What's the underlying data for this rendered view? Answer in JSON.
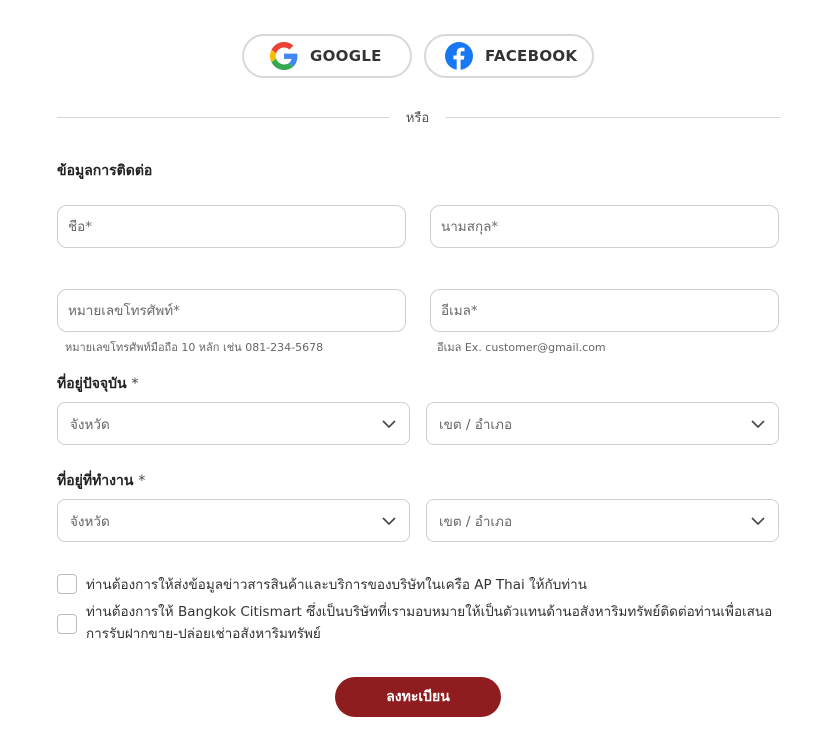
{
  "social": {
    "google_label": "GOOGLE",
    "facebook_label": "FACEBOOK"
  },
  "divider_text": "หรือ",
  "contact": {
    "title": "ข้อมูลการติดต่อ",
    "first_name_placeholder": "ชื่อ*",
    "last_name_placeholder": "นามสกุล*",
    "phone_placeholder": "หมายเลขโทรศัพท์*",
    "email_placeholder": "อีเมล*",
    "phone_hint": "หมายเลขโทรศัพท์มือถือ 10 หลัก เช่น 081-234-5678",
    "email_hint": "อีเมล Ex. customer@gmail.com"
  },
  "current_address": {
    "title": "ที่อยู่ปัจจุบัน",
    "required_mark": "*",
    "province": "จังหวัด",
    "district": "เขต / อำเภอ"
  },
  "work_address": {
    "title": "ที่อยู่ที่ทำงาน",
    "required_mark": "*",
    "province": "จังหวัด",
    "district": "เขต / อำเภอ"
  },
  "consents": [
    "ท่านต้องการให้ส่งข้อมูลข่าวสารสินค้าและบริการของบริษัทในเครือ AP Thai ให้กับท่าน",
    "ท่านต้องการให้ Bangkok Citismart ซึ่งเป็นบริษัทที่เรามอบหมายให้เป็นตัวแทนด้านอสังหาริมทรัพย์ติดต่อท่านเพื่อเสนอการรับฝากขาย-ปล่อยเช่าอสังหาริมทรัพย์"
  ],
  "submit_label": "ลงทะเบียน",
  "colors": {
    "primary": "#8f1c1f",
    "facebook": "#1877f2",
    "border": "#cfcfcf"
  }
}
